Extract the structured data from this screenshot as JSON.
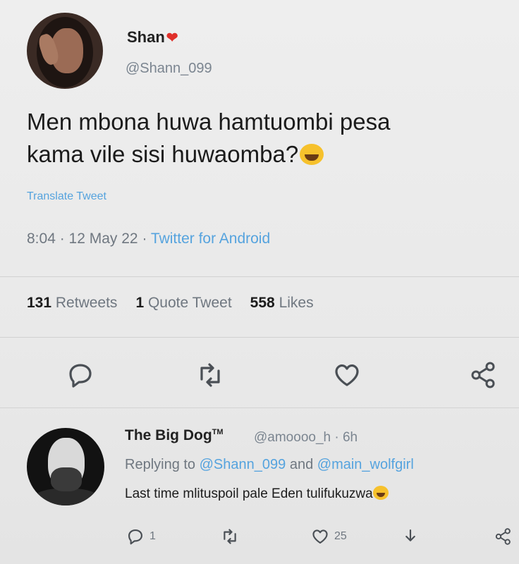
{
  "tweet": {
    "author_name": "Shan",
    "author_name_emoji": "❤",
    "handle": "@Shann_099",
    "text_line1": "Men mbona huwa hamtuombi pesa",
    "text_line2": "kama vile sisi huwaomba?",
    "translate_label": "Translate Tweet",
    "time": "8:04",
    "date": "12 May 22",
    "source": "Twitter for Android",
    "retweets_count": "131",
    "retweets_label": "Retweets",
    "quotes_count": "1",
    "quotes_label": "Quote Tweet",
    "likes_count": "558",
    "likes_label": "Likes"
  },
  "reply": {
    "author_name": "The Big Dog",
    "author_name_mark": "TM",
    "handle": "@amoooo_h",
    "age": "6h",
    "replying_prefix": "Replying to",
    "replying_user1": "@Shann_099",
    "replying_and": "and",
    "replying_user2": "@main_wolfgirl",
    "text": "Last time mlituspoil pale Eden tulifukuzwa",
    "reply_count": "1",
    "like_count": "25"
  },
  "colors": {
    "link": "#55a3de",
    "muted": "#6f7780",
    "text": "#1c1c1c"
  },
  "icons": [
    "reply-icon",
    "retweet-icon",
    "like-icon",
    "share-icon",
    "laughing-emoji-icon",
    "heart-emoji-icon"
  ]
}
